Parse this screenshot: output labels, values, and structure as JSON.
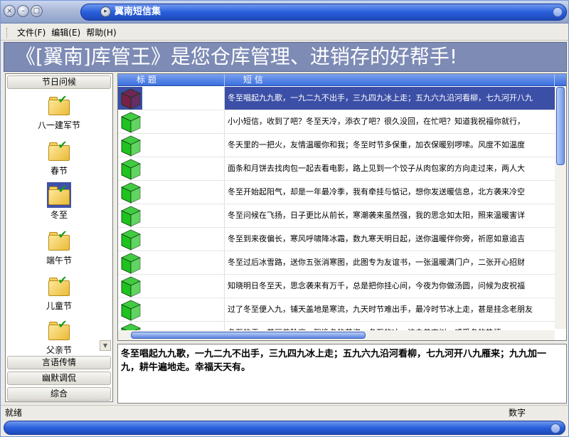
{
  "window": {
    "title": "翼南短信集",
    "btn_close": "×",
    "btn_min": "–",
    "btn_max": "□",
    "btn_orb": "▸"
  },
  "menu": [
    {
      "label": "文件(F)"
    },
    {
      "label": "编辑(E)"
    },
    {
      "label": "帮助(H)"
    }
  ],
  "banner": {
    "text": "《[翼南]库管王》是您仓库管理、进销存的好帮手!"
  },
  "sidebar": {
    "top_group": "节日问候",
    "items": [
      {
        "label": "八一建军节",
        "icon": "folder-check-icon"
      },
      {
        "label": "春节",
        "icon": "folder-check-icon"
      },
      {
        "label": "冬至",
        "icon": "folder-check-icon",
        "selected": true
      },
      {
        "label": "端午节",
        "icon": "folder-check-icon"
      },
      {
        "label": "儿童节",
        "icon": "folder-check-icon"
      },
      {
        "label": "父亲节",
        "icon": "folder-check-icon"
      }
    ],
    "bottom_groups": [
      "言语传情",
      "幽默调侃",
      "综合"
    ],
    "scroll_arrow": "▼"
  },
  "table": {
    "columns": [
      "标 题",
      "短 信"
    ],
    "rows": [
      {
        "title": "",
        "message": "冬至唱起九九歌，一九二九不出手，三九四九冰上走；五九六九沿河看柳，七九河开八九",
        "selected": true,
        "cube_color": "#7a2048"
      },
      {
        "title": "",
        "message": "小小短信，收到了吧？冬至天冷，添衣了吧？很久没回，在忙吧？知道我祝福你就行，",
        "cube_color": "#1fc21f"
      },
      {
        "title": "",
        "message": "冬天里的一把火，友情温暖你和我；冬至时节多保重，加衣保暖别啰嗦。风度不如温度",
        "cube_color": "#1fc21f"
      },
      {
        "title": "",
        "message": "面条和月饼去找肉包一起去看电影，路上见到一个饺子从肉包家的方向走过来，两人大",
        "cube_color": "#1fc21f"
      },
      {
        "title": "",
        "message": "冬至开始起阳气，却是一年最冷季，我有牵挂与惦记，想你发送暖信息，北方袭来冷空",
        "cube_color": "#1fc21f"
      },
      {
        "title": "",
        "message": "冬至问候在飞扬，日子更比从前长，寒潮袭来虽然强，我的思念如太阳，照来温暖害详",
        "cube_color": "#1fc21f"
      },
      {
        "title": "",
        "message": "冬至到来夜偏长，寒风呼啸降冰霜，数九寒天明日起，送你温暖伴你旁，祈愿如意追吉",
        "cube_color": "#1fc21f"
      },
      {
        "title": "",
        "message": "冬至过后冰雪路，送你五张消寒图，此图专为友谊书，一张温暖满门户，二张开心招财",
        "cube_color": "#1fc21f"
      },
      {
        "title": "",
        "message": "知晓明日冬至天，思念袭来有万千，总是把你挂心间，今夜为你做汤圆，问候为皮祝福",
        "cube_color": "#1fc21f"
      },
      {
        "title": "",
        "message": "过了冬至便入九，铺天盖地是寒流，九天时节难出手，最冷时节冰上走，甚是挂念老朋友",
        "cube_color": "#1fc21f"
      },
      {
        "title": "",
        "message": "冬至的雪，美丽着阶庭，飘逸冬的英姿；冬至的冰，洁白着高树，感受冬的热情。",
        "cube_color": "#1fc21f"
      }
    ]
  },
  "detail": {
    "text": "冬至唱起九九歌，一九二九不出手，三九四九冰上走；五九六九沿河看柳，七九河开八九雁来；九九加一九，耕牛遍地走。幸福天天有。"
  },
  "statusbar": {
    "left": "就绪",
    "right": "数字"
  },
  "colors": {
    "accent": "#2a5fdc",
    "selection": "#3c4fa7",
    "banner": "#7d8bb5"
  }
}
